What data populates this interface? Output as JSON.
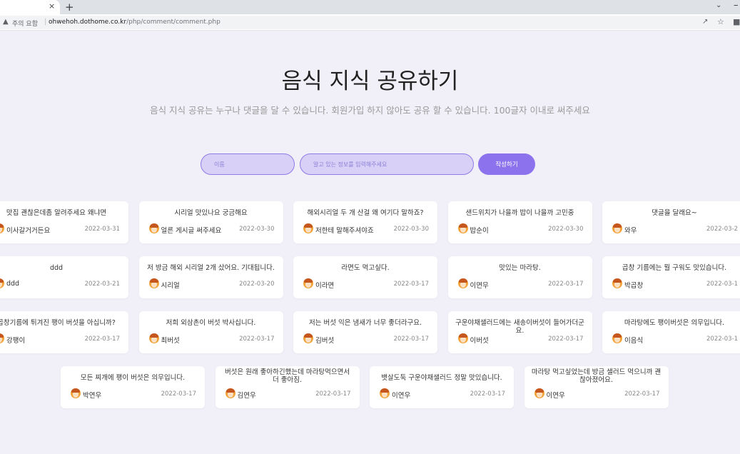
{
  "browser": {
    "tab_close": "×",
    "new_tab": "+",
    "warning_text": "주의 요함",
    "url_host": "ohwehoh.dothome.co.kr",
    "url_path": "/php/comment/comment.php"
  },
  "page": {
    "title": "음식 지식 공유하기",
    "subtitle": "음식 지식 공유는 누구나 댓글을 달 수 있습니다. 회원가입 하지 않아도 공유 할 수 있습니다. 100글자 이내로 써주세요"
  },
  "form": {
    "name_placeholder": "이름",
    "info_placeholder": "알고 있는 정보를 입력해주세요",
    "submit_label": "작성하기"
  },
  "colors": {
    "background": "#f1f0f8",
    "input_fill": "#d8d0f6",
    "accent": "#8c72ec"
  },
  "comments": [
    {
      "text": "맛집 괜찮은데좀 알려주세요 왜냐면",
      "author": "이사갈거거든요",
      "date": "2022-03-31"
    },
    {
      "text": "시리얼 맛있나요 궁금해요",
      "author": "얼른 게시글 써주세요",
      "date": "2022-03-30"
    },
    {
      "text": "해외시리얼 두 개 산걸 왜 여기다 말하죠?",
      "author": "저한테 말해주셔야죠",
      "date": "2022-03-30"
    },
    {
      "text": "샌드위치가 나을까 밥이 나을까 고민중",
      "author": "밥순이",
      "date": "2022-03-30"
    },
    {
      "text": "댓글을 달래요~",
      "author": "와우",
      "date": "2022-03-2"
    },
    {
      "text": "ddd",
      "author": "ddd",
      "date": "2022-03-21"
    },
    {
      "text": "저 방금 해외 시리얼 2개 샀어요. 기대됩니다.",
      "author": "시리얼",
      "date": "2022-03-20"
    },
    {
      "text": "라면도 먹고싶다.",
      "author": "이라면",
      "date": "2022-03-17"
    },
    {
      "text": "맛있는 마라탕.",
      "author": "이면무",
      "date": "2022-03-17"
    },
    {
      "text": "곱창 기름에는 뭘 구워도 맛있습니다.",
      "author": "박곱창",
      "date": "2022-03-1"
    },
    {
      "text": "곱창기름에 튀겨진 팽이 버섯을 아십니까?",
      "author": "강팽이",
      "date": "2022-03-17"
    },
    {
      "text": "저희 외삼촌이 버섯 박사십니다.",
      "author": "최버섯",
      "date": "2022-03-17"
    },
    {
      "text": "저는 버섯 익은 냄새가 너무 좋더라구요.",
      "author": "김버섯",
      "date": "2022-03-17"
    },
    {
      "text": "구운야채샐러드에는 새송이버섯이 들어가더군요.",
      "author": "이버섯",
      "date": "2022-03-17"
    },
    {
      "text": "마라탕에도 팽이버섯은 의무입니다.",
      "author": "이음식",
      "date": "2022-03-1"
    },
    {
      "text": "모든 찌개에 팽이 버섯은 의무입니다.",
      "author": "박연우",
      "date": "2022-03-17"
    },
    {
      "text": "버섯은 원래 좋아하긴했는데 마라탕먹으면서 더 좋아짐.",
      "author": "김연우",
      "date": "2022-03-17"
    },
    {
      "text": "뱃살도둑 구운야채샐러드 정말 맛있습니다.",
      "author": "이연우",
      "date": "2022-03-17"
    },
    {
      "text": "마라탕 먹고싶었는데 방금 샐러드 먹으니까 괜찮아졌어요.",
      "author": "이연우",
      "date": "2022-03-17"
    }
  ]
}
